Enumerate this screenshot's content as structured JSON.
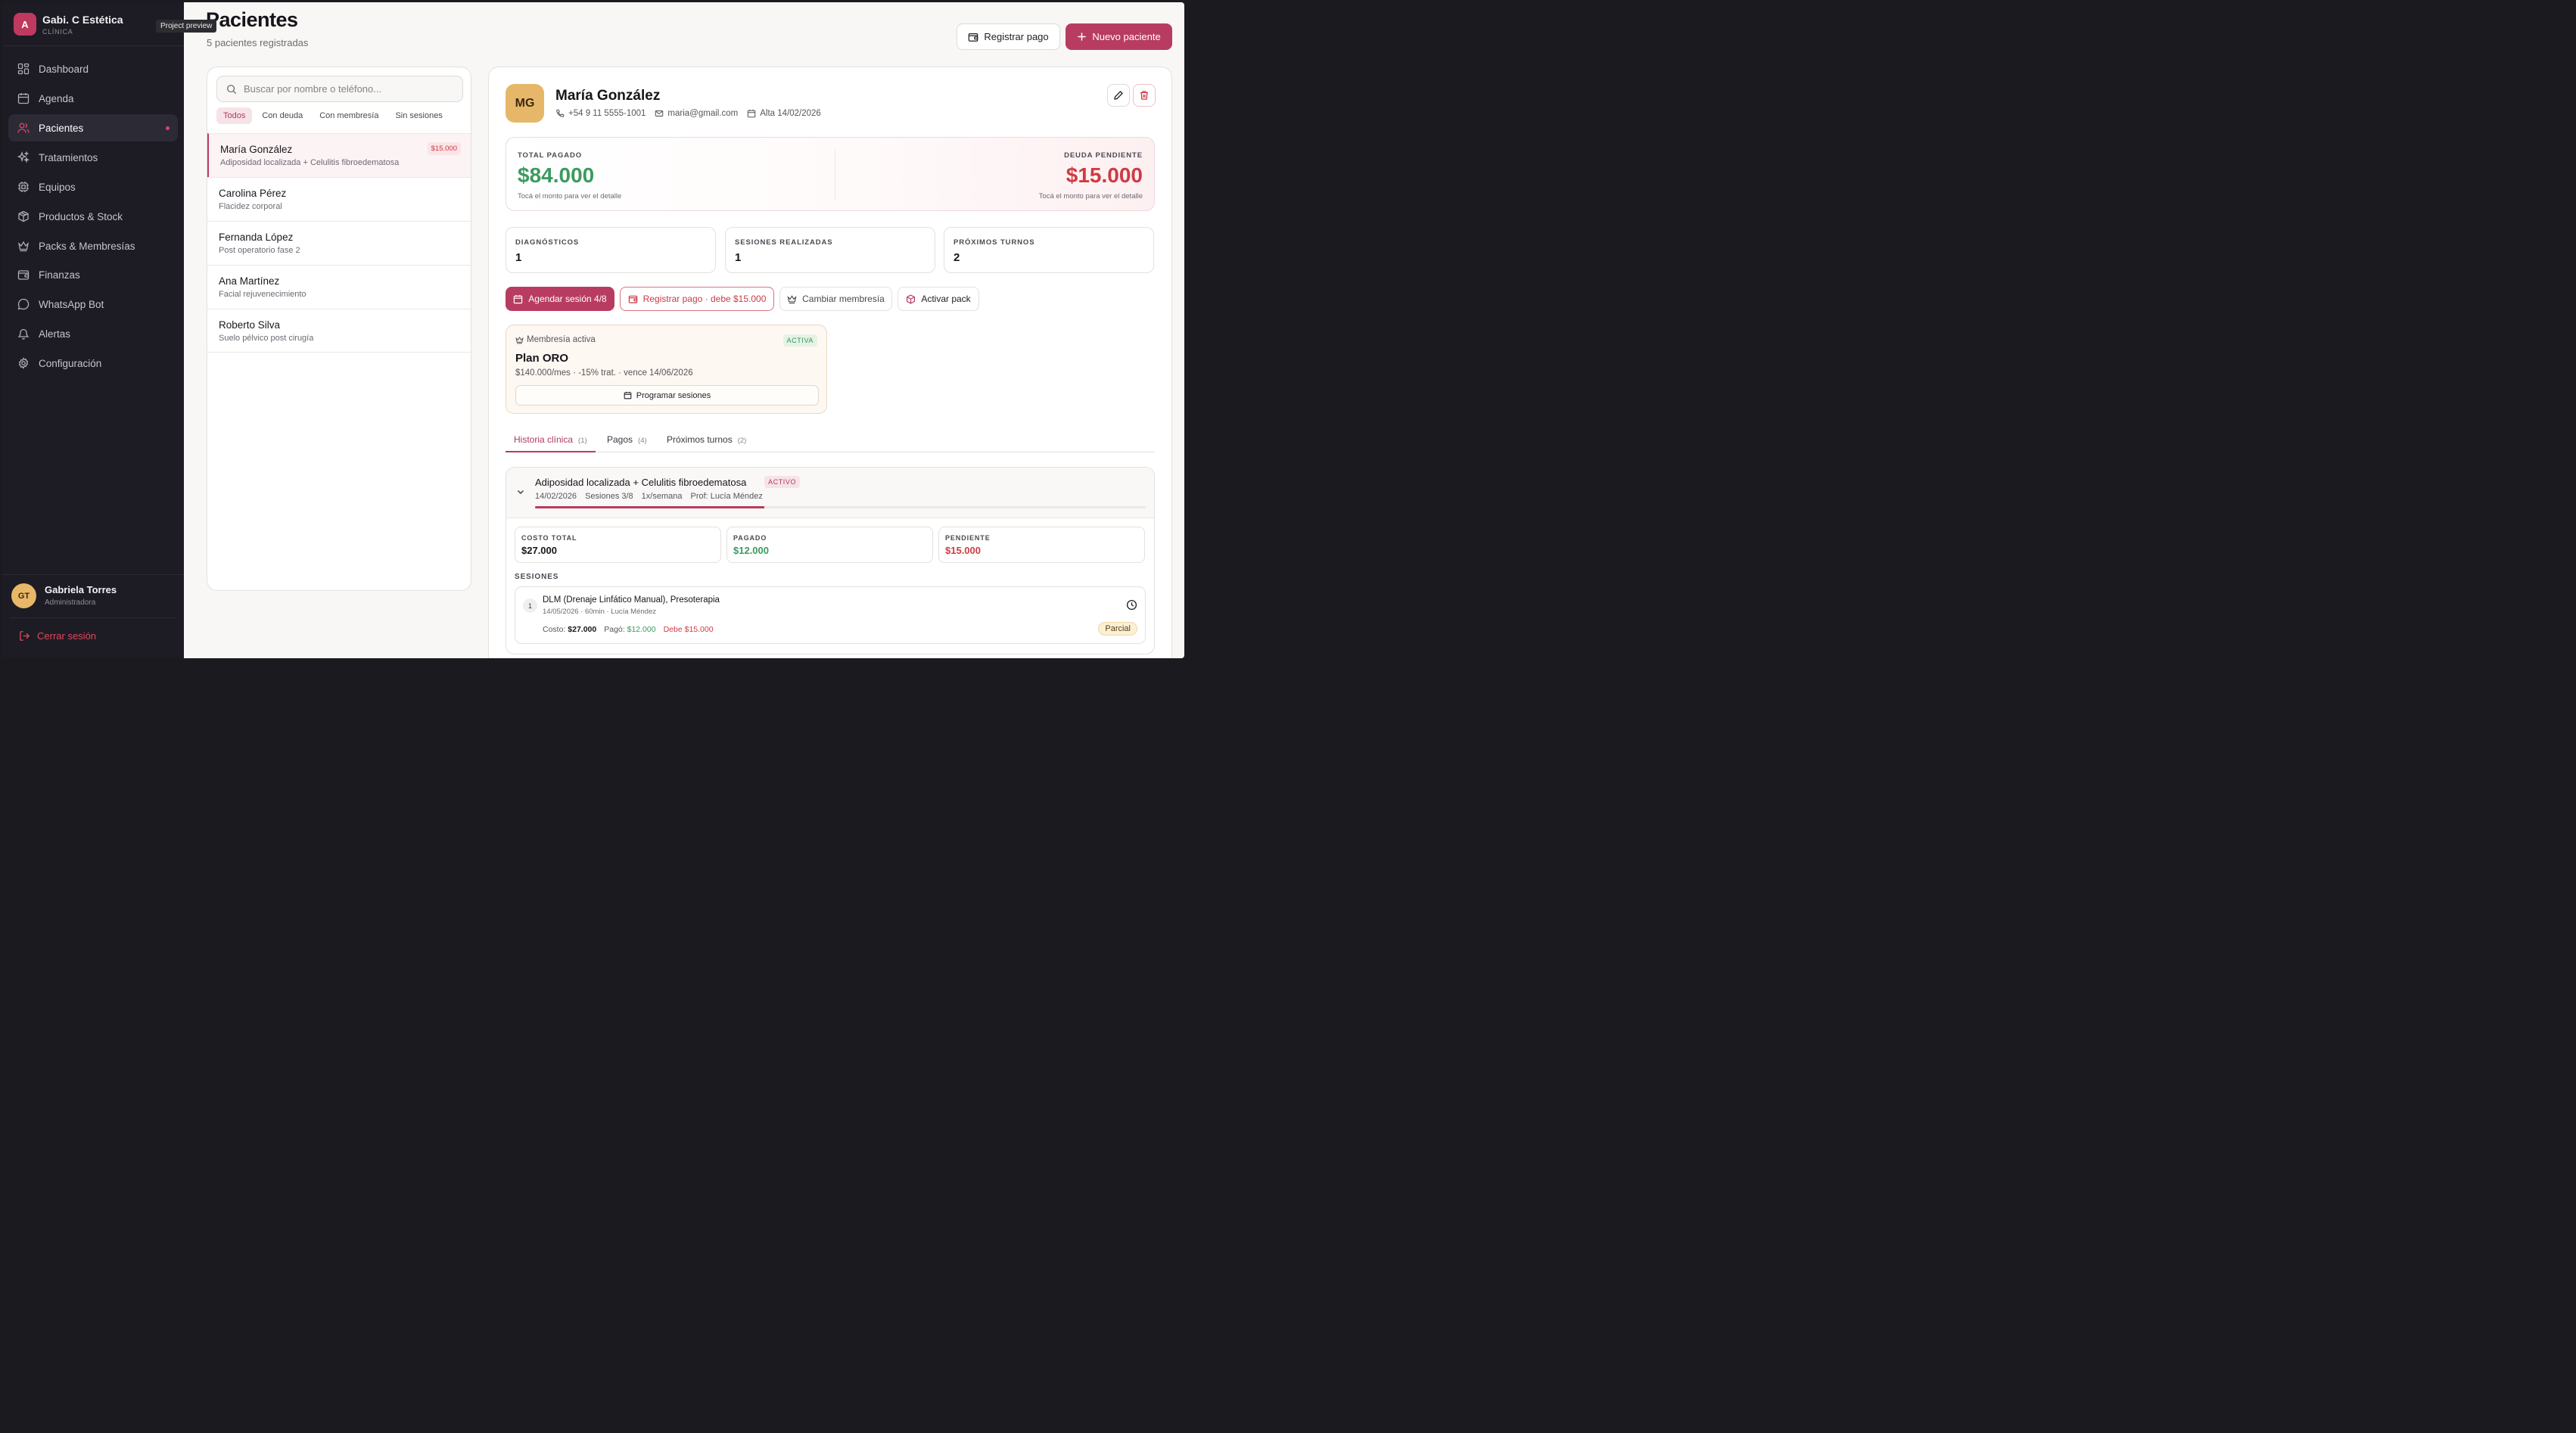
{
  "sidebar": {
    "logo_letter": "A",
    "brand_name": "Gabi. C Estética",
    "brand_sub": "CLÍNICA",
    "tooltip": "Project preview",
    "items": [
      {
        "label": "Dashboard",
        "icon": "dashboard-icon"
      },
      {
        "label": "Agenda",
        "icon": "calendar-icon"
      },
      {
        "label": "Pacientes",
        "icon": "users-icon",
        "active": true
      },
      {
        "label": "Tratamientos",
        "icon": "sparkles-icon"
      },
      {
        "label": "Equipos",
        "icon": "cpu-icon"
      },
      {
        "label": "Productos & Stock",
        "icon": "package-icon"
      },
      {
        "label": "Packs & Membresías",
        "icon": "crown-icon"
      },
      {
        "label": "Finanzas",
        "icon": "wallet-icon"
      },
      {
        "label": "WhatsApp Bot",
        "icon": "message-icon"
      },
      {
        "label": "Alertas",
        "icon": "bell-icon"
      },
      {
        "label": "Configuración",
        "icon": "gear-icon"
      }
    ],
    "user": {
      "initials": "GT",
      "name": "Gabriela Torres",
      "role": "Administradora"
    },
    "logout_label": "Cerrar sesión"
  },
  "header": {
    "title": "Pacientes",
    "subtitle": "5 pacientes registradas",
    "register_payment_label": "Registrar pago",
    "new_patient_label": "Nuevo paciente"
  },
  "list": {
    "search_placeholder": "Buscar por nombre o teléfono...",
    "filters": [
      "Todos",
      "Con deuda",
      "Con membresía",
      "Sin sesiones"
    ],
    "patients": [
      {
        "name": "María González",
        "sub": "Adiposidad localizada + Celulitis fibroedematosa",
        "badge": "$15.000",
        "selected": true
      },
      {
        "name": "Carolina Pérez",
        "sub": "Flacidez corporal"
      },
      {
        "name": "Fernanda López",
        "sub": "Post operatorio fase 2"
      },
      {
        "name": "Ana Martínez",
        "sub": "Facial rejuvenecimiento"
      },
      {
        "name": "Roberto Silva",
        "sub": "Suelo pélvico post cirugía"
      }
    ]
  },
  "detail": {
    "initials": "MG",
    "name": "María González",
    "phone": "+54 9 11 5555-1001",
    "email": "maria@gmail.com",
    "since": "Alta 14/02/2026",
    "total_paid_label": "TOTAL PAGADO",
    "total_paid": "$84.000",
    "debt_label": "DEUDA PENDIENTE",
    "debt": "$15.000",
    "hint": "Tocá el monto para ver el detalle",
    "stats": [
      {
        "label": "DIAGNÓSTICOS",
        "value": "1"
      },
      {
        "label": "SESIONES REALIZADAS",
        "value": "1"
      },
      {
        "label": "PRÓXIMOS TURNOS",
        "value": "2"
      }
    ],
    "actions": {
      "schedule": "Agendar sesión 4/8",
      "pay": "Registrar pago · debe $15.000",
      "membership": "Cambiar membresía",
      "pack": "Activar pack"
    },
    "membership": {
      "label": "Membresía activa",
      "badge": "ACTIVA",
      "plan": "Plan ORO",
      "desc": "$140.000/mes · -15% trat. · vence 14/06/2026",
      "button": "Programar sesiones"
    },
    "tabs": [
      {
        "label": "Historia clínica",
        "count": "(1)"
      },
      {
        "label": "Pagos",
        "count": "(4)"
      },
      {
        "label": "Próximos turnos",
        "count": "(2)"
      }
    ],
    "treatment": {
      "title": "Adiposidad localizada + Celulitis fibroedematosa",
      "badge": "ACTIVO",
      "date": "14/02/2026",
      "sessions": "Sesiones 3/8",
      "freq": "1x/semana",
      "prof": "Prof: Lucía Méndez",
      "progress": 0.375,
      "costs": [
        {
          "label": "COSTO TOTAL",
          "value": "$27.000"
        },
        {
          "label": "PAGADO",
          "value": "$12.000"
        },
        {
          "label": "PENDIENTE",
          "value": "$15.000"
        }
      ],
      "sessions_label": "SESIONES",
      "session": {
        "num": "1",
        "title": "DLM (Drenaje Linfático Manual), Presoterapia",
        "meta": "14/05/2026 · 60min · Lucía Méndez",
        "cost_label": "Costo:",
        "cost": "$27.000",
        "paid_label": "Pagó:",
        "paid": "$12.000",
        "debt": "Debe $15.000",
        "status": "Parcial"
      }
    }
  },
  "colors": {
    "accent": "#b83c61",
    "sidebar_bg": "#1d1c24",
    "success": "#3b9a5f",
    "danger": "#d03a43",
    "avatar": "#e7b769"
  }
}
